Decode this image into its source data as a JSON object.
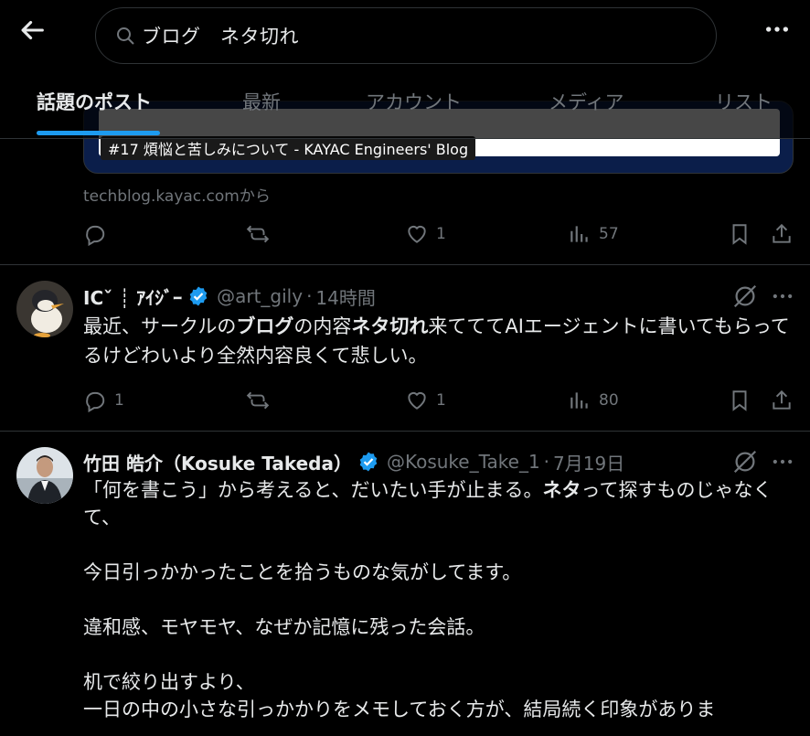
{
  "search": {
    "query": "ブログ　ネタ切れ"
  },
  "tabs": [
    {
      "label": "話題のポスト",
      "active": true
    },
    {
      "label": "最新"
    },
    {
      "label": "アカウント"
    },
    {
      "label": "メディア"
    },
    {
      "label": "リスト"
    }
  ],
  "link_card": {
    "caption": "#17 煩悩と苦しみについて - KAYAC Engineers' Blog",
    "source": "techblog.kayac.comから"
  },
  "tweet0": {
    "reply_count": "",
    "repost_count": "",
    "like_count": "1",
    "view_count": "57"
  },
  "tweet1": {
    "display_name": "ICˇ ┊ ｱｲｼﾞｰ",
    "handle": "@art_gily",
    "time": "14時間",
    "text_parts": [
      "最近、サークルの",
      "ブログ",
      "の内容",
      "ネタ切れ",
      "来てててAIエージェントに書いてもらってるけどわいより全然内容良くて悲しい。"
    ],
    "reply_count": "1",
    "repost_count": "",
    "like_count": "1",
    "view_count": "80"
  },
  "tweet2": {
    "display_name": "竹田 皓介（Kosuke Takeda）",
    "handle": "@Kosuke_Take_1",
    "time": "7月19日",
    "text_parts": [
      "「何を書こう」から考えると、だいたい手が止まる。",
      "ネタ",
      "って探すものじゃなくて、\n\n今日引っかかったことを拾うものな気がしてます。\n\n違和感、モヤモヤ、なぜか記憶に残った会話。\n\n机で絞り出すより、\n一日の中の小さな引っかかりをメモしておく方が、結局続く印象がありま"
    ]
  },
  "colors": {
    "accent": "#1d9bf0",
    "muted": "#71767b",
    "text": "#e7e9ea",
    "background": "#000000",
    "border": "#2f3336"
  },
  "icons": [
    "back-arrow-icon",
    "search-icon",
    "more-icon",
    "reply-icon",
    "repost-icon",
    "like-icon",
    "views-icon",
    "bookmark-icon",
    "share-icon",
    "verified-icon",
    "grok-icon"
  ]
}
